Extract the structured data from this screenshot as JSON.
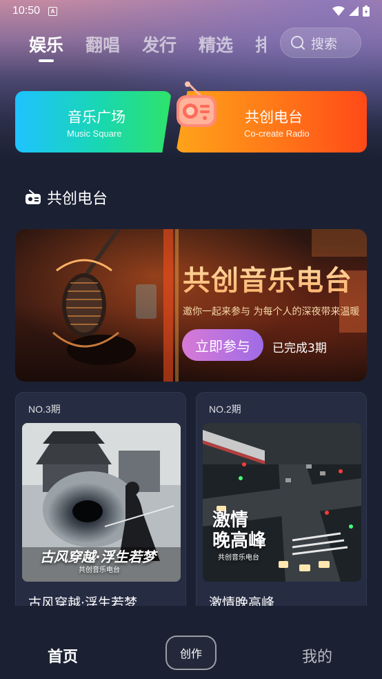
{
  "status_bar": {
    "time": "10:50",
    "notification_letter": "A"
  },
  "tabs": [
    {
      "label": "娱乐",
      "active": true
    },
    {
      "label": "翻唱",
      "active": false
    },
    {
      "label": "发行",
      "active": false
    },
    {
      "label": "精选",
      "active": false
    },
    {
      "label": "排",
      "active": false
    }
  ],
  "search": {
    "placeholder": "搜索"
  },
  "cards": {
    "music_square": {
      "title": "音乐广场",
      "subtitle": "Music Square"
    },
    "cocreate_radio": {
      "title": "共创电台",
      "subtitle": "Co-create Radio"
    }
  },
  "section": {
    "title": "共创电台"
  },
  "banner": {
    "title": "共创音乐电台",
    "slogan": "邀你一起来参与 为每个人的深夜带来温暖",
    "join_label": "立即参与",
    "completed_text": "已完成3期"
  },
  "episodes": [
    {
      "number": "NO.3期",
      "title": "古风穿越·浮生若梦",
      "cover_title": "古风穿越·浮生若梦",
      "cover_sub": "共创音乐电台"
    },
    {
      "number": "NO.2期",
      "title": "激情晚高峰",
      "cover_title_line1": "激情",
      "cover_title_line2": "晚高峰",
      "cover_sub": "共创音乐电台"
    }
  ],
  "bottom_nav": {
    "home": "首页",
    "create": "创作",
    "mine": "我的"
  },
  "colors": {
    "background": "#1b2133",
    "card_bg": "#262c42",
    "join_button": "#b26fe0"
  }
}
